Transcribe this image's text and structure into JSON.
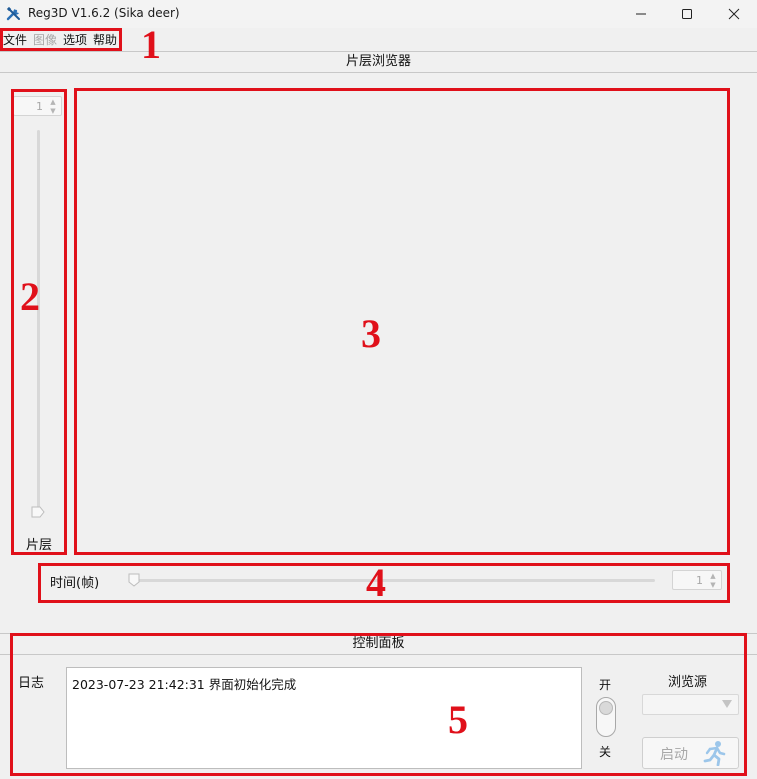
{
  "window": {
    "title": "Reg3D V1.6.2 (Sika deer)",
    "icons": {
      "app": "tools-icon",
      "minimize": "minimize-icon",
      "maximize": "maximize-icon",
      "close": "close-icon"
    }
  },
  "menu": {
    "items": [
      {
        "label": "文件",
        "enabled": true
      },
      {
        "label": "图像",
        "enabled": false
      },
      {
        "label": "选项",
        "enabled": true
      },
      {
        "label": "帮助",
        "enabled": true
      }
    ]
  },
  "browser": {
    "header": "片层浏览器",
    "slice_spin_value": "1",
    "slice_label": "片层",
    "time_label": "时间(帧)",
    "time_spin_value": "1"
  },
  "control_panel": {
    "header": "控制面板",
    "log_label": "日志",
    "log_lines": [
      "2023-07-23 21:42:31 界面初始化完成"
    ],
    "toggle_on_label": "开",
    "toggle_off_label": "关",
    "source_label": "浏览源",
    "source_value": "",
    "start_label": "启动",
    "start_icon": "running-person-icon"
  },
  "annotations": {
    "color": "#e0101a",
    "labels": [
      "1",
      "2",
      "3",
      "4",
      "5"
    ]
  }
}
